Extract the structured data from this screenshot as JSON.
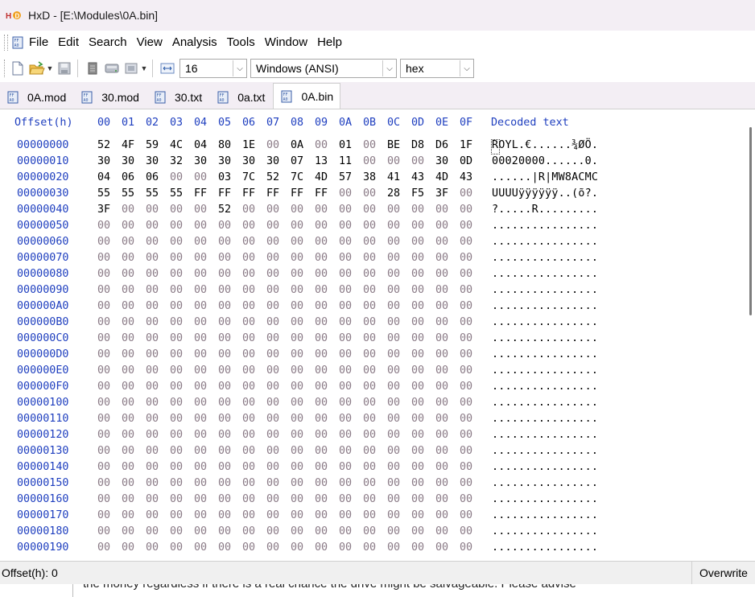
{
  "window": {
    "title": "HxD - [E:\\Modules\\0A.bin]"
  },
  "menu": [
    "File",
    "Edit",
    "Search",
    "View",
    "Analysis",
    "Tools",
    "Window",
    "Help"
  ],
  "toolbar": {
    "bytes_per_row": "16",
    "charset": "Windows (ANSI)",
    "offset_base": "hex"
  },
  "tabs": [
    {
      "label": "0A.mod",
      "active": false
    },
    {
      "label": "30.mod",
      "active": false
    },
    {
      "label": "30.txt",
      "active": false
    },
    {
      "label": "0a.txt",
      "active": false
    },
    {
      "label": "0A.bin",
      "active": true
    }
  ],
  "editor": {
    "offset_header": "Offset(h)",
    "column_headers": [
      "00",
      "01",
      "02",
      "03",
      "04",
      "05",
      "06",
      "07",
      "08",
      "09",
      "0A",
      "0B",
      "0C",
      "0D",
      "0E",
      "0F"
    ],
    "decoded_header": "Decoded text",
    "rows": [
      {
        "offset": "00000000",
        "bytes": [
          "52",
          "4F",
          "59",
          "4C",
          "04",
          "80",
          "1E",
          "00",
          "0A",
          "00",
          "01",
          "00",
          "BE",
          "D8",
          "D6",
          "1F"
        ],
        "decoded": "ROYL.€......¾ØÖ."
      },
      {
        "offset": "00000010",
        "bytes": [
          "30",
          "30",
          "30",
          "32",
          "30",
          "30",
          "30",
          "30",
          "07",
          "13",
          "11",
          "00",
          "00",
          "00",
          "30",
          "0D"
        ],
        "decoded": "00020000......0."
      },
      {
        "offset": "00000020",
        "bytes": [
          "04",
          "06",
          "06",
          "00",
          "00",
          "03",
          "7C",
          "52",
          "7C",
          "4D",
          "57",
          "38",
          "41",
          "43",
          "4D",
          "43"
        ],
        "decoded": "......|R|MW8ACMC"
      },
      {
        "offset": "00000030",
        "bytes": [
          "55",
          "55",
          "55",
          "55",
          "FF",
          "FF",
          "FF",
          "FF",
          "FF",
          "FF",
          "00",
          "00",
          "28",
          "F5",
          "3F",
          "00"
        ],
        "decoded": "UUUUÿÿÿÿÿÿ..(õ?."
      },
      {
        "offset": "00000040",
        "bytes": [
          "3F",
          "00",
          "00",
          "00",
          "00",
          "52",
          "00",
          "00",
          "00",
          "00",
          "00",
          "00",
          "00",
          "00",
          "00",
          "00"
        ],
        "decoded": "?.....R........."
      },
      {
        "offset": "00000050",
        "bytes": [
          "00",
          "00",
          "00",
          "00",
          "00",
          "00",
          "00",
          "00",
          "00",
          "00",
          "00",
          "00",
          "00",
          "00",
          "00",
          "00"
        ],
        "decoded": "................"
      },
      {
        "offset": "00000060",
        "bytes": [
          "00",
          "00",
          "00",
          "00",
          "00",
          "00",
          "00",
          "00",
          "00",
          "00",
          "00",
          "00",
          "00",
          "00",
          "00",
          "00"
        ],
        "decoded": "................"
      },
      {
        "offset": "00000070",
        "bytes": [
          "00",
          "00",
          "00",
          "00",
          "00",
          "00",
          "00",
          "00",
          "00",
          "00",
          "00",
          "00",
          "00",
          "00",
          "00",
          "00"
        ],
        "decoded": "................"
      },
      {
        "offset": "00000080",
        "bytes": [
          "00",
          "00",
          "00",
          "00",
          "00",
          "00",
          "00",
          "00",
          "00",
          "00",
          "00",
          "00",
          "00",
          "00",
          "00",
          "00"
        ],
        "decoded": "................"
      },
      {
        "offset": "00000090",
        "bytes": [
          "00",
          "00",
          "00",
          "00",
          "00",
          "00",
          "00",
          "00",
          "00",
          "00",
          "00",
          "00",
          "00",
          "00",
          "00",
          "00"
        ],
        "decoded": "................"
      },
      {
        "offset": "000000A0",
        "bytes": [
          "00",
          "00",
          "00",
          "00",
          "00",
          "00",
          "00",
          "00",
          "00",
          "00",
          "00",
          "00",
          "00",
          "00",
          "00",
          "00"
        ],
        "decoded": "................"
      },
      {
        "offset": "000000B0",
        "bytes": [
          "00",
          "00",
          "00",
          "00",
          "00",
          "00",
          "00",
          "00",
          "00",
          "00",
          "00",
          "00",
          "00",
          "00",
          "00",
          "00"
        ],
        "decoded": "................"
      },
      {
        "offset": "000000C0",
        "bytes": [
          "00",
          "00",
          "00",
          "00",
          "00",
          "00",
          "00",
          "00",
          "00",
          "00",
          "00",
          "00",
          "00",
          "00",
          "00",
          "00"
        ],
        "decoded": "................"
      },
      {
        "offset": "000000D0",
        "bytes": [
          "00",
          "00",
          "00",
          "00",
          "00",
          "00",
          "00",
          "00",
          "00",
          "00",
          "00",
          "00",
          "00",
          "00",
          "00",
          "00"
        ],
        "decoded": "................"
      },
      {
        "offset": "000000E0",
        "bytes": [
          "00",
          "00",
          "00",
          "00",
          "00",
          "00",
          "00",
          "00",
          "00",
          "00",
          "00",
          "00",
          "00",
          "00",
          "00",
          "00"
        ],
        "decoded": "................"
      },
      {
        "offset": "000000F0",
        "bytes": [
          "00",
          "00",
          "00",
          "00",
          "00",
          "00",
          "00",
          "00",
          "00",
          "00",
          "00",
          "00",
          "00",
          "00",
          "00",
          "00"
        ],
        "decoded": "................"
      },
      {
        "offset": "00000100",
        "bytes": [
          "00",
          "00",
          "00",
          "00",
          "00",
          "00",
          "00",
          "00",
          "00",
          "00",
          "00",
          "00",
          "00",
          "00",
          "00",
          "00"
        ],
        "decoded": "................"
      },
      {
        "offset": "00000110",
        "bytes": [
          "00",
          "00",
          "00",
          "00",
          "00",
          "00",
          "00",
          "00",
          "00",
          "00",
          "00",
          "00",
          "00",
          "00",
          "00",
          "00"
        ],
        "decoded": "................"
      },
      {
        "offset": "00000120",
        "bytes": [
          "00",
          "00",
          "00",
          "00",
          "00",
          "00",
          "00",
          "00",
          "00",
          "00",
          "00",
          "00",
          "00",
          "00",
          "00",
          "00"
        ],
        "decoded": "................"
      },
      {
        "offset": "00000130",
        "bytes": [
          "00",
          "00",
          "00",
          "00",
          "00",
          "00",
          "00",
          "00",
          "00",
          "00",
          "00",
          "00",
          "00",
          "00",
          "00",
          "00"
        ],
        "decoded": "................"
      },
      {
        "offset": "00000140",
        "bytes": [
          "00",
          "00",
          "00",
          "00",
          "00",
          "00",
          "00",
          "00",
          "00",
          "00",
          "00",
          "00",
          "00",
          "00",
          "00",
          "00"
        ],
        "decoded": "................"
      },
      {
        "offset": "00000150",
        "bytes": [
          "00",
          "00",
          "00",
          "00",
          "00",
          "00",
          "00",
          "00",
          "00",
          "00",
          "00",
          "00",
          "00",
          "00",
          "00",
          "00"
        ],
        "decoded": "................"
      },
      {
        "offset": "00000160",
        "bytes": [
          "00",
          "00",
          "00",
          "00",
          "00",
          "00",
          "00",
          "00",
          "00",
          "00",
          "00",
          "00",
          "00",
          "00",
          "00",
          "00"
        ],
        "decoded": "................"
      },
      {
        "offset": "00000170",
        "bytes": [
          "00",
          "00",
          "00",
          "00",
          "00",
          "00",
          "00",
          "00",
          "00",
          "00",
          "00",
          "00",
          "00",
          "00",
          "00",
          "00"
        ],
        "decoded": "................"
      },
      {
        "offset": "00000180",
        "bytes": [
          "00",
          "00",
          "00",
          "00",
          "00",
          "00",
          "00",
          "00",
          "00",
          "00",
          "00",
          "00",
          "00",
          "00",
          "00",
          "00"
        ],
        "decoded": "................"
      },
      {
        "offset": "00000190",
        "bytes": [
          "00",
          "00",
          "00",
          "00",
          "00",
          "00",
          "00",
          "00",
          "00",
          "00",
          "00",
          "00",
          "00",
          "00",
          "00",
          "00"
        ],
        "decoded": "................"
      }
    ]
  },
  "status": {
    "offset_label": "Offset(h): 0",
    "mode": "Overwrite"
  },
  "background_window": {
    "text": "the money regardless if there is a real chance the drive might be salvageable. Please advise"
  },
  "colors": {
    "offset_blue": "#1f3fbf",
    "byte_black": "#000000",
    "byte_gray": "#8a7a86"
  }
}
